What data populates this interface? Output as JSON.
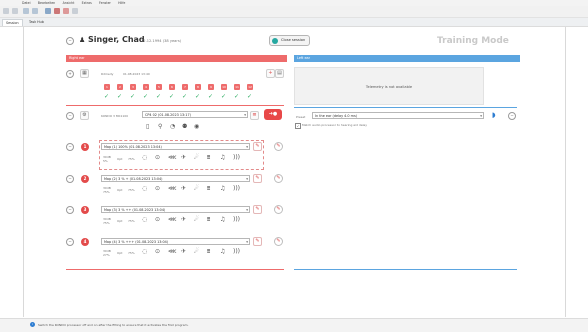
{
  "menu": [
    "Datei",
    "Bearbeiten",
    "Ansicht",
    "Extras",
    "Fenster",
    "Hilfe"
  ],
  "tabs": [
    {
      "label": "Session"
    },
    {
      "label": "Task Hub"
    }
  ],
  "header": {
    "patient_name": "Singer, Chad",
    "patient_info": "12.12.1994 (38 years)",
    "close_session_label": "Close session",
    "mode_label": "Training Mode"
  },
  "right_ear": {
    "title": "Right ear",
    "date_label": "Rdmedy",
    "date_value": "01.08.2023 13:40",
    "channels": [
      "1",
      "2",
      "3",
      "4",
      "5",
      "6",
      "7",
      "8",
      "9",
      "10",
      "11",
      "12"
    ],
    "device_label": "KONDO 3 MK1100",
    "device_value": "CP4 02 (01.08.2023 13:17)",
    "programs": [
      {
        "number": "1",
        "name": "Map (1) 100% (01.08.2023 13:04)",
        "stats_top": "30dB",
        "stats_bottom": "5%",
        "a": "Opt",
        "b": "75%"
      },
      {
        "number": "2",
        "name": "Map (2) 3 % + (01.08.2023 13:04)",
        "stats_top": "30dB",
        "stats_bottom": "75%",
        "a": "Opt",
        "b": "75%"
      },
      {
        "number": "3",
        "name": "Map (3) 3 % ++ (01.08.2023 13:04)",
        "stats_top": "30dB",
        "stats_bottom": "75%",
        "a": "Opt",
        "b": "75%"
      },
      {
        "number": "4",
        "name": "Map (4) 3 % +++ (01.08.2023 13:04)",
        "stats_top": "30dB",
        "stats_bottom": "27%",
        "a": "Opt",
        "b": "75%"
      }
    ]
  },
  "left_ear": {
    "title": "Left ear",
    "telemetry_text": "Telemetry is not available",
    "processor_label": "Preset",
    "processor_value": "In the ear (delay 4.0 ms)",
    "checkbox_label": "Match audio processor to hearing aid delay"
  },
  "status": {
    "text": "Switch the KONDO processor off and on after the fitting to ensure that it activates the first program."
  },
  "colors": {
    "right": "#ee6b6b",
    "left": "#5ba5e0",
    "check": "#23a95b",
    "accent": "#26a8a1"
  }
}
